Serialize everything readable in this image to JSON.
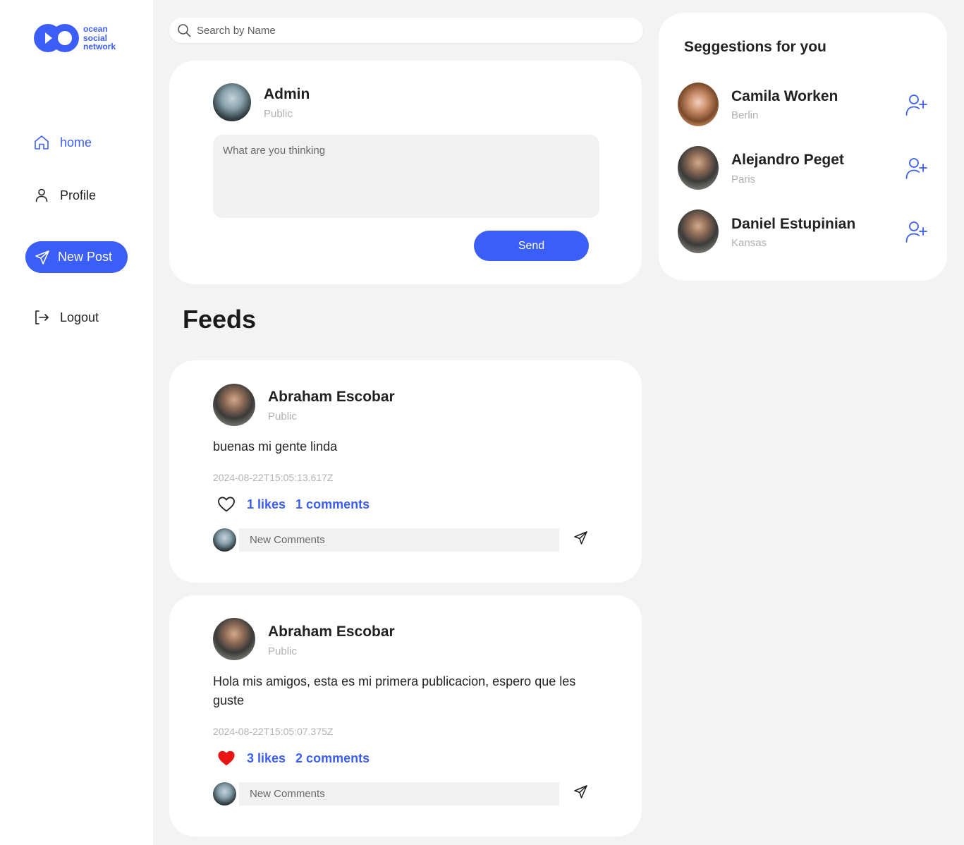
{
  "logo": {
    "line1": "ocean",
    "line2": "social",
    "line3": "network"
  },
  "nav": {
    "home": "home",
    "profile": "Profile",
    "new_post": "New Post",
    "logout": "Logout"
  },
  "search": {
    "placeholder": "Search by Name"
  },
  "composer": {
    "user_name": "Admin",
    "visibility": "Public",
    "placeholder": "What are you thinking",
    "send_label": "Send"
  },
  "feeds_title": "Feeds",
  "posts": [
    {
      "author": "Abraham Escobar",
      "visibility": "Public",
      "text": "buenas mi gente linda",
      "date": "2024-08-22T15:05:13.617Z",
      "likes": "1 likes",
      "comments": "1 comments",
      "liked": false,
      "comment_placeholder": "New Comments"
    },
    {
      "author": "Abraham Escobar",
      "visibility": "Public",
      "text": "Hola mis amigos, esta es mi primera publicacion, espero que les guste",
      "date": "2024-08-22T15:05:07.375Z",
      "likes": "3 likes",
      "comments": "2 comments",
      "liked": true,
      "comment_placeholder": "New Comments"
    }
  ],
  "suggestions": {
    "title": "Seggestions for you",
    "people": [
      {
        "name": "Camila Worken",
        "city": "Berlin"
      },
      {
        "name": "Alejandro Peget",
        "city": "Paris"
      },
      {
        "name": "Daniel Estupinian",
        "city": "Kansas"
      }
    ]
  },
  "colors": {
    "accent": "#3b5ef7",
    "like": "#e81416",
    "background": "#f3f3f3"
  }
}
